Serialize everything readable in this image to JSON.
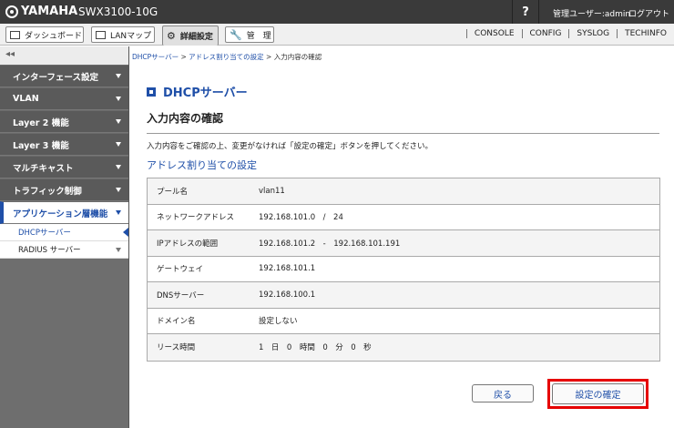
{
  "header": {
    "brand": "YAMAHA",
    "model": "SWX3100-10G",
    "help_label": "?",
    "user_label": "管理ユーザー:admin",
    "logout_label": "ログアウト"
  },
  "tabs": [
    {
      "label": "ダッシュボード"
    },
    {
      "label": "LANマップ"
    },
    {
      "label": "詳細設定"
    },
    {
      "label": "管　理"
    }
  ],
  "right_links": [
    "CONSOLE",
    "CONFIG",
    "SYSLOG",
    "TECHINFO"
  ],
  "sidebar": {
    "collapse_label": "◂◂",
    "items": [
      {
        "label": "インターフェース設定"
      },
      {
        "label": "VLAN"
      },
      {
        "label": "Layer 2 機能"
      },
      {
        "label": "Layer 3 機能"
      },
      {
        "label": "マルチキャスト"
      },
      {
        "label": "トラフィック制御"
      },
      {
        "label": "アプリケーション層機能"
      }
    ],
    "subitems": [
      {
        "label": "DHCPサーバー"
      },
      {
        "label": "RADIUS サーバー"
      }
    ]
  },
  "breadcrumb": {
    "part1": "DHCPサーバー",
    "part2": "アドレス割り当ての設定",
    "part3": "入力内容の確認",
    "sep": " > "
  },
  "page": {
    "title": "DHCPサーバー",
    "subtitle": "入力内容の確認",
    "instruction": "入力内容をご確認の上、変更がなければ「設定の確定」ボタンを押してください。",
    "section": "アドレス割り当ての設定"
  },
  "table": [
    {
      "label": "プール名",
      "value": "vlan11"
    },
    {
      "label": "ネットワークアドレス",
      "value": "192.168.101.0　/　24"
    },
    {
      "label": "IPアドレスの範囲",
      "value": "192.168.101.2　-　192.168.101.191"
    },
    {
      "label": "ゲートウェイ",
      "value": "192.168.101.1"
    },
    {
      "label": "DNSサーバー",
      "value": "192.168.100.1"
    },
    {
      "label": "ドメイン名",
      "value": "設定しない"
    },
    {
      "label": "リース時間",
      "value": "1　日　0　時間　0　分　0　秒"
    }
  ],
  "buttons": {
    "back": "戻る",
    "confirm": "設定の確定"
  },
  "colors": {
    "accent": "#1f4fa8",
    "highlight": "#e60000",
    "topbar": "#3a3a3a",
    "sidebar": "#5a5a5a"
  }
}
